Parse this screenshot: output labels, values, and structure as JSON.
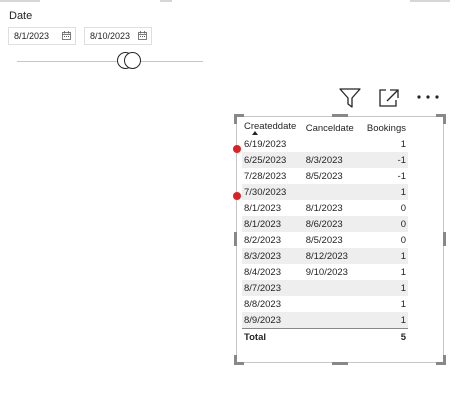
{
  "slicer": {
    "title": "Date",
    "start_date": "8/1/2023",
    "end_date": "8/10/2023"
  },
  "visual_header": {
    "icons": [
      "filter-icon",
      "focus-mode-icon",
      "more-options-icon"
    ]
  },
  "table": {
    "columns": [
      "Createddate",
      "Canceldate",
      "Bookings"
    ],
    "sorted_column": "Createddate",
    "rows": [
      {
        "created": "6/19/2023",
        "cancel": "",
        "bookings": "1",
        "flagged": true
      },
      {
        "created": "6/25/2023",
        "cancel": "8/3/2023",
        "bookings": "-1",
        "flagged": false
      },
      {
        "created": "7/28/2023",
        "cancel": "8/5/2023",
        "bookings": "-1",
        "flagged": false
      },
      {
        "created": "7/30/2023",
        "cancel": "",
        "bookings": "1",
        "flagged": true
      },
      {
        "created": "8/1/2023",
        "cancel": "8/1/2023",
        "bookings": "0",
        "flagged": false
      },
      {
        "created": "8/1/2023",
        "cancel": "8/6/2023",
        "bookings": "0",
        "flagged": false
      },
      {
        "created": "8/2/2023",
        "cancel": "8/5/2023",
        "bookings": "0",
        "flagged": false
      },
      {
        "created": "8/3/2023",
        "cancel": "8/12/2023",
        "bookings": "1",
        "flagged": false
      },
      {
        "created": "8/4/2023",
        "cancel": "9/10/2023",
        "bookings": "1",
        "flagged": false
      },
      {
        "created": "8/7/2023",
        "cancel": "",
        "bookings": "1",
        "flagged": false
      },
      {
        "created": "8/8/2023",
        "cancel": "",
        "bookings": "1",
        "flagged": false
      },
      {
        "created": "8/9/2023",
        "cancel": "",
        "bookings": "1",
        "flagged": false
      }
    ],
    "total": {
      "label": "Total",
      "bookings": "5"
    }
  },
  "colors": {
    "marker_dot": "#e02020",
    "row_stripe": "#eeeeee",
    "border": "#c8c6c4"
  }
}
